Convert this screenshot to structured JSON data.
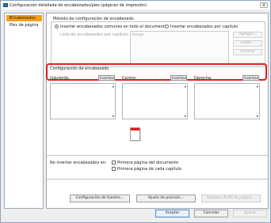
{
  "window": {
    "title": "Configuración detallada de encabezados/pies (páginas de impresión)",
    "close_glyph": "×"
  },
  "sidebar": {
    "items": [
      {
        "label": "Encabezados",
        "active": true
      },
      {
        "label": "Pies de página",
        "active": false
      }
    ]
  },
  "method": {
    "title": "Método de configuración de encabezado",
    "radio_common_label": "Insertar encabezados comunes en todo el documento",
    "radio_common_selected": true,
    "radio_chapter_label": "Insertar encabezados por capítulo",
    "radio_chapter_selected": false,
    "list_label": "Lista de encabezados por capítulo:",
    "range_placeholder": "Rango",
    "add_label": "Agregar...",
    "edit_label": "Editar...",
    "delete_label": "Eliminar"
  },
  "header_config": {
    "title": "Configuración de encabezado",
    "columns": [
      {
        "label": "Izquierda:",
        "insert_label": "Insertar▾"
      },
      {
        "label": "Centro:",
        "insert_label": "Insertar▾"
      },
      {
        "label": "Derecha:",
        "insert_label": "Insertar▾"
      }
    ],
    "scroll_up_glyph": "▲",
    "scroll_down_glyph": "▼"
  },
  "no_insert": {
    "label": "No insertar encabezados en:",
    "option_first_doc": "Primera página del documento",
    "option_first_chapter": "Primera página de cada capítulo",
    "option_first_doc_checked": false,
    "option_first_chapter_checked": false
  },
  "actions": {
    "font_label": "Configuración de fuentes...",
    "position_label": "Ajuste de posición...",
    "page_number_label": "Detalles de Nº de página..."
  },
  "dialog": {
    "accept_label": "Aceptar",
    "cancel_label": "Cancelar",
    "apply_label": "Aplicar"
  },
  "colors": {
    "sidebar_active": "#f5a01a",
    "highlight": "#e21d1d",
    "window_bg": "#eeeeee",
    "primary_border": "#4c87c9"
  }
}
